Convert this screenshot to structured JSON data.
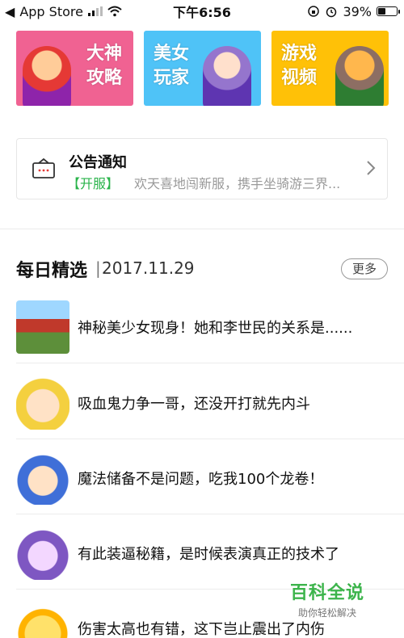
{
  "status_bar": {
    "carrier": "App Store",
    "time": "下午6:56",
    "battery": "39%",
    "battery_level": 0.39
  },
  "banners": [
    {
      "label_line1": "大神",
      "label_line2": "攻略",
      "color": "#f06292"
    },
    {
      "label_line1": "美女",
      "label_line2": "玩家",
      "color": "#4fc3f7"
    },
    {
      "label_line1": "游戏",
      "label_line2": "视频",
      "color": "#ffc107"
    }
  ],
  "notice": {
    "title": "公告通知",
    "tag": "【开服】",
    "text": "欢天喜地闯新服，携手坐骑游三界..."
  },
  "daily": {
    "title": "每日精选",
    "separator": "|",
    "date": "2017.11.29",
    "more": "更多",
    "items": [
      {
        "title": "神秘美少女现身！她和李世民的关系是......"
      },
      {
        "title": "吸血鬼力争一哥，还没开打就先内斗"
      },
      {
        "title": "魔法储备不是问题，吃我100个龙卷！"
      },
      {
        "title": "有此装逼秘籍，是时候表演真正的技术了"
      },
      {
        "title": "伤害太高也有错，这下岂止震出了内伤"
      }
    ]
  },
  "watermark": {
    "title": "百科全说",
    "subtitle": "助你轻松解决"
  },
  "colors": {
    "accent_green": "#29b34a",
    "muted_text": "#9a9a9a"
  }
}
